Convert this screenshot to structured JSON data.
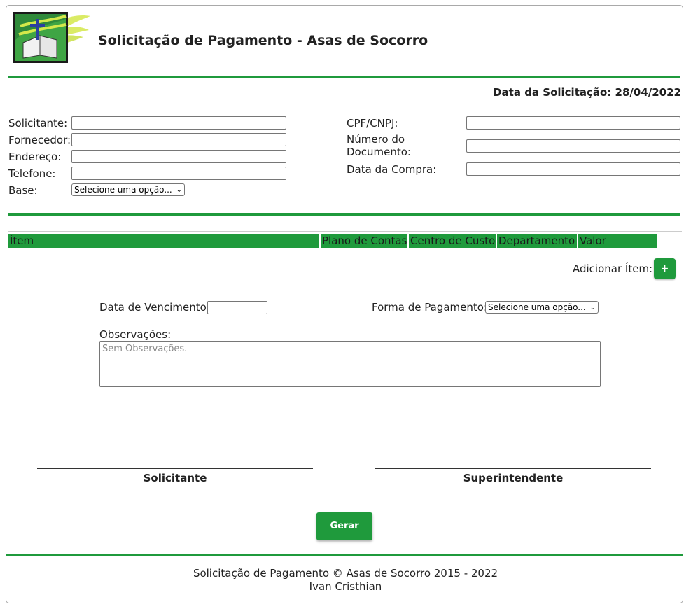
{
  "header": {
    "title": "Solicitação de Pagamento - Asas de Socorro",
    "request_date": "Data da Solicitação: 28/04/2022"
  },
  "form": {
    "solicitante_label": "Solicitante:",
    "fornecedor_label": "Fornecedor:",
    "endereco_label": "Endereço:",
    "telefone_label": "Telefone:",
    "base_label": "Base:",
    "base_select": "Selecione uma opção...",
    "cpf_label": "CPF/CNPJ:",
    "numero_label": "Número do Documento:",
    "data_compra_label": "Data da Compra:"
  },
  "table": {
    "columns": [
      "Ítem",
      "Plano de Contas",
      "Centro de Custo",
      "Departamento",
      "Valor"
    ]
  },
  "items": {
    "add_label": "Adicionar Ítem:",
    "add_button": "+"
  },
  "payment": {
    "vencimento_label": "Data de Vencimento:",
    "forma_label": "Forma de Pagamento:",
    "forma_select": "Selecione uma opção...",
    "obs_label": "Observações:",
    "obs_placeholder": "Sem Observações."
  },
  "signatures": {
    "left": "Solicitante",
    "right": "Superintendente"
  },
  "actions": {
    "gerar": "Gerar"
  },
  "footer": {
    "line1": "Solicitação de Pagamento © Asas de Socorro 2015 - 2022",
    "line2": "Ivan Cristhian"
  },
  "colors": {
    "brand_green": "#1f9a3c"
  }
}
